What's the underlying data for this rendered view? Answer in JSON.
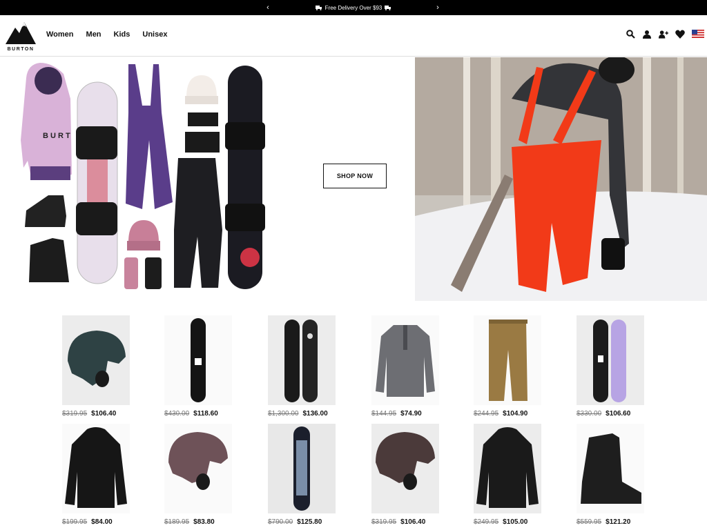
{
  "promo": {
    "message": "Free Delivery Over $93",
    "prev": "‹",
    "next": "›"
  },
  "brand": {
    "name": "BURTON"
  },
  "nav": [
    {
      "label": "Women"
    },
    {
      "label": "Men"
    },
    {
      "label": "Kids"
    },
    {
      "label": "Unisex"
    }
  ],
  "header_icons": [
    "search-icon",
    "account-icon",
    "add-user-icon",
    "wishlist-heart-icon",
    "us-flag-icon"
  ],
  "hero": {
    "cta_label": "SHOP NOW"
  },
  "colors": {
    "promo_bg": "#000000",
    "overalls": "#f23a18",
    "accent_text": "#111111"
  },
  "products": [
    {
      "item": "helmet",
      "old_price": "$319.95",
      "price": "$106.40"
    },
    {
      "item": "snowboard",
      "old_price": "$430.00",
      "price": "$118.60"
    },
    {
      "item": "snowboard-pair",
      "old_price": "$1,300.00",
      "price": "$136.00"
    },
    {
      "item": "fleece-pullover",
      "old_price": "$144.95",
      "price": "$74.90"
    },
    {
      "item": "snow-pants",
      "old_price": "$244.95",
      "price": "$104.90"
    },
    {
      "item": "snowboard-pair-purple",
      "old_price": "$330.00",
      "price": "$106.60"
    },
    {
      "item": "puffer-jacket",
      "old_price": "$199.95",
      "price": "$84.00"
    },
    {
      "item": "helmet-mauve",
      "old_price": "$189.95",
      "price": "$83.80"
    },
    {
      "item": "snowboard-graphic",
      "old_price": "$790.00",
      "price": "$125.80"
    },
    {
      "item": "helmet-brown",
      "old_price": "$319.95",
      "price": "$106.40"
    },
    {
      "item": "shell-jacket",
      "old_price": "$249.95",
      "price": "$105.00"
    },
    {
      "item": "snowboard-boot",
      "old_price": "$559.95",
      "price": "$121.20"
    }
  ]
}
